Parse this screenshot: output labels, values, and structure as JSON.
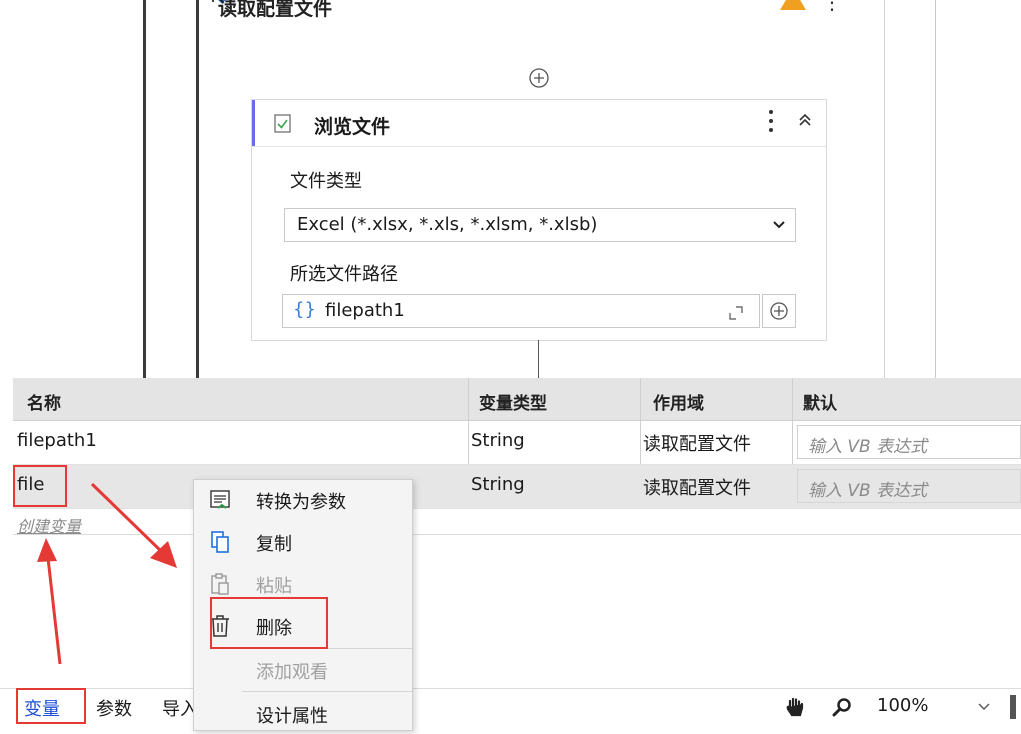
{
  "designer": {
    "outer_activity_title": "读取配置文件",
    "inner_activity": {
      "title": "浏览文件",
      "file_type_label": "文件类型",
      "file_type_value": "Excel (*.xlsx, *.xls, *.xlsm, *.xlsb)",
      "path_label": "所选文件路径",
      "path_value": "filepath1",
      "path_brace": "{}"
    }
  },
  "variables": {
    "headers": {
      "name": "名称",
      "type": "变量类型",
      "scope": "作用域",
      "default": "默认"
    },
    "rows": [
      {
        "name": "filepath1",
        "type": "String",
        "scope": "读取配置文件",
        "default_placeholder": "输入 VB 表达式",
        "selected": false
      },
      {
        "name": "file",
        "type": "String",
        "scope": "读取配置文件",
        "default_placeholder": "输入 VB 表达式",
        "selected": true
      }
    ],
    "create_label": "创建变量"
  },
  "bottom_tabs": {
    "variables": "变量",
    "arguments": "参数",
    "imports": "导入"
  },
  "zoom": {
    "value": "100%"
  },
  "context_menu": {
    "items": [
      {
        "label": "转换为参数",
        "icon": "convert-to-argument-icon",
        "enabled": true
      },
      {
        "label": "复制",
        "icon": "copy-icon",
        "enabled": true
      },
      {
        "label": "粘贴",
        "icon": "paste-icon",
        "enabled": false
      },
      {
        "label": "删除",
        "icon": "delete-icon",
        "enabled": true
      },
      {
        "label": "添加观看",
        "icon": "",
        "enabled": false
      },
      {
        "label": "设计属性",
        "icon": "",
        "enabled": true
      }
    ]
  },
  "colors": {
    "accent_blue": "#1d4fd8",
    "annotation_red": "#e53935",
    "activity_accent": "#6b6bf0"
  }
}
